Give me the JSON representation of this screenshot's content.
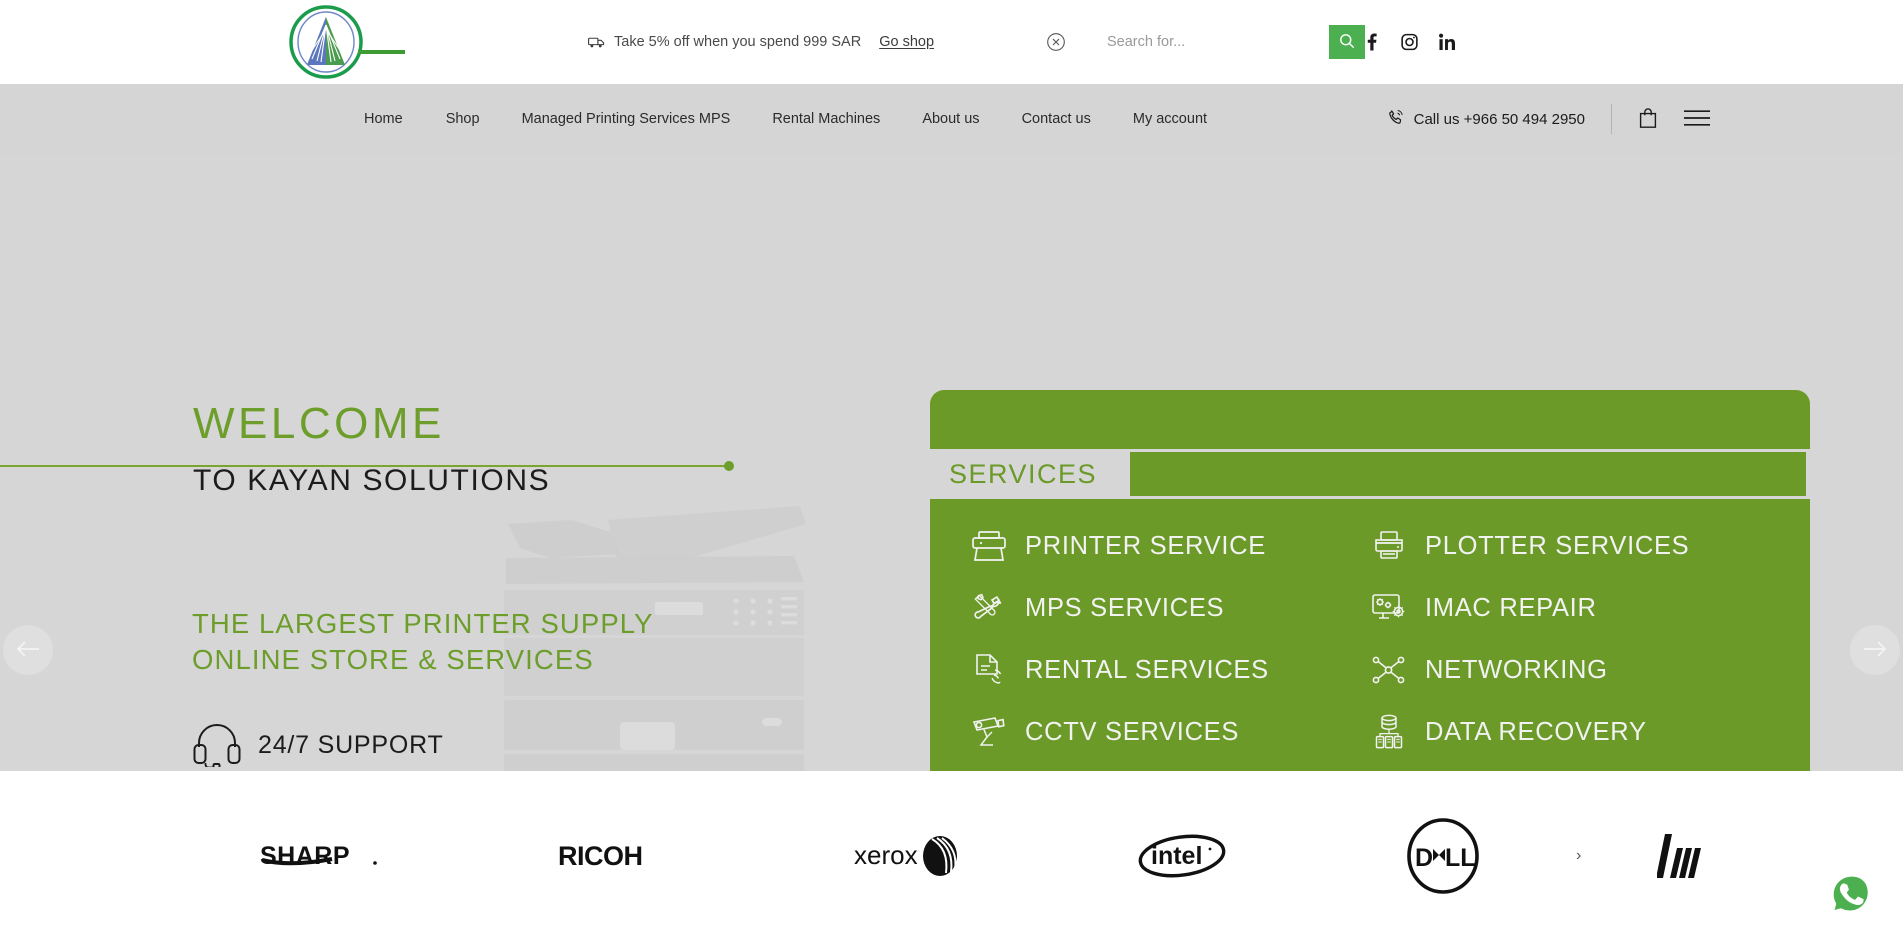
{
  "topbar": {
    "logo_alt": "Kayan Solutions logo",
    "promo_text": "Take 5% off when you spend 999 SAR",
    "promo_link": "Go shop",
    "truck_icon": "delivery-truck-icon",
    "close_icon": "close-circle-icon",
    "search_placeholder": "Search for...",
    "search_value": "",
    "search_icon": "search-icon",
    "accent_green": "#4caf50",
    "socials": [
      {
        "name": "facebook",
        "label": "f"
      },
      {
        "name": "instagram",
        "label": "Instagram"
      },
      {
        "name": "linkedin",
        "label": "in"
      }
    ]
  },
  "nav": {
    "items": [
      {
        "label": "Home",
        "active": true
      },
      {
        "label": "Shop",
        "active": false
      },
      {
        "label": "Managed Printing Services MPS",
        "active": false
      },
      {
        "label": "Rental Machines",
        "active": false
      },
      {
        "label": "About us",
        "active": false
      },
      {
        "label": "Contact us",
        "active": false
      },
      {
        "label": "My account",
        "active": false
      }
    ],
    "call_text": "Call us +966 50 494 2950",
    "phone_icon": "phone-icon",
    "bag_icon": "shopping-bag-icon",
    "menu_icon": "hamburger-menu-icon",
    "bar_color": "#d5d5d5",
    "active_indicator_color": "#3f9c35"
  },
  "hero": {
    "welcome": "WELCOME",
    "welcome_sub": "TO KAYAN SOLUTIONS",
    "headline_line1": "THE LARGEST PRINTER SUPPLY",
    "headline_line2": "ONLINE STORE & SERVICES",
    "support_text": "24/7 SUPPORT",
    "headset_icon": "headset-icon",
    "printer_illustration": "copier-illustration",
    "green": "#6d9e2b",
    "background": "#d6d6d6",
    "prev_label": "Previous slide",
    "next_label": "Next slide",
    "prev_icon": "arrow-left-icon",
    "next_icon": "arrow-right-icon"
  },
  "services": {
    "title": "SERVICES",
    "panel_color": "#6b9a28",
    "items": [
      {
        "label": "PRINTER SERVICE",
        "icon": "printer-icon"
      },
      {
        "label": "PLOTTER SERVICES",
        "icon": "plotter-icon"
      },
      {
        "label": "MPS SERVICES",
        "icon": "tools-icon"
      },
      {
        "label": "IMAC REPAIR",
        "icon": "monitor-gears-icon"
      },
      {
        "label": "RENTAL SERVICES",
        "icon": "document-hand-icon"
      },
      {
        "label": "NETWORKING",
        "icon": "network-nodes-icon"
      },
      {
        "label": "CCTV SERVICES",
        "icon": "cctv-camera-icon"
      },
      {
        "label": "DATA RECOVERY",
        "icon": "server-data-icon"
      }
    ]
  },
  "brands": {
    "items": [
      {
        "name": "sharp",
        "label": "SHARP"
      },
      {
        "name": "ricoh",
        "label": "RICOH"
      },
      {
        "name": "xerox",
        "label": "xerox"
      },
      {
        "name": "intel",
        "label": "intel"
      },
      {
        "name": "dell",
        "label": "DELL"
      },
      {
        "name": "hp",
        "label": "hp"
      }
    ],
    "next_arrow": "›"
  },
  "floating": {
    "whatsapp_icon": "whatsapp-icon",
    "whatsapp_color": "#4caf50"
  }
}
